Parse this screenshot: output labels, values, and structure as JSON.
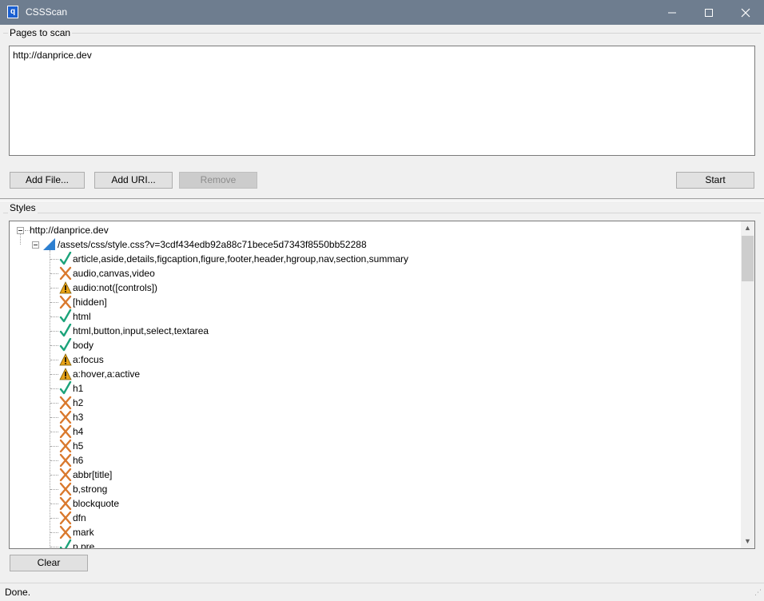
{
  "window": {
    "title": "CSSScan",
    "app_icon": "app-logo-icon",
    "controls": [
      "minimize-icon",
      "maximize-icon",
      "close-icon"
    ]
  },
  "pages_group": {
    "label": "Pages to scan",
    "urls": [
      "http://danprice.dev"
    ]
  },
  "buttons": {
    "add_file": "Add File...",
    "add_uri": "Add URI...",
    "remove": "Remove",
    "start": "Start",
    "clear": "Clear"
  },
  "styles_group": {
    "label": "Styles",
    "root": "http://danprice.dev",
    "stylesheet": "/assets/css/style.css?v=3cdf434edb92a88c71bece5d7343f8550bb52288",
    "rules": [
      {
        "selector": "article,aside,details,figcaption,figure,footer,header,hgroup,nav,section,summary",
        "status": "check"
      },
      {
        "selector": "audio,canvas,video",
        "status": "cross"
      },
      {
        "selector": "audio:not([controls])",
        "status": "warning"
      },
      {
        "selector": "[hidden]",
        "status": "cross"
      },
      {
        "selector": "html",
        "status": "check"
      },
      {
        "selector": "html,button,input,select,textarea",
        "status": "check"
      },
      {
        "selector": "body",
        "status": "check"
      },
      {
        "selector": "a:focus",
        "status": "warning"
      },
      {
        "selector": "a:hover,a:active",
        "status": "warning"
      },
      {
        "selector": "h1",
        "status": "check"
      },
      {
        "selector": "h2",
        "status": "cross"
      },
      {
        "selector": "h3",
        "status": "cross"
      },
      {
        "selector": "h4",
        "status": "cross"
      },
      {
        "selector": "h5",
        "status": "cross"
      },
      {
        "selector": "h6",
        "status": "cross"
      },
      {
        "selector": "abbr[title]",
        "status": "cross"
      },
      {
        "selector": "b,strong",
        "status": "cross"
      },
      {
        "selector": "blockquote",
        "status": "cross"
      },
      {
        "selector": "dfn",
        "status": "cross"
      },
      {
        "selector": "mark",
        "status": "cross"
      },
      {
        "selector": "p,pre",
        "status": "check"
      }
    ]
  },
  "status_bar": {
    "text": "Done."
  },
  "colors": {
    "titlebar": "#6e7d8f",
    "check": "#1ba37a",
    "cross": "#d9782c",
    "warning": "#e8a317",
    "stylesheet_icon": "#2d7fd0"
  }
}
